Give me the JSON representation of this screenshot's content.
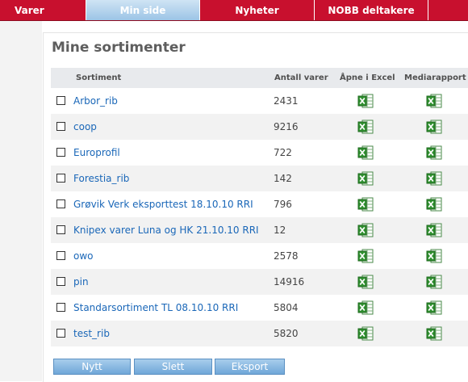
{
  "nav": {
    "tabs": [
      {
        "label": "Varer"
      },
      {
        "label": "Min side"
      },
      {
        "label": "Nyheter"
      },
      {
        "label": "NOBB deltakere"
      }
    ]
  },
  "main": {
    "title": "Mine sortimenter",
    "columns": {
      "sortiment": "Sortiment",
      "antall": "Antall varer",
      "excel": "Åpne i Excel",
      "media": "Mediarapport"
    },
    "rows": [
      {
        "name": "Arbor_rib",
        "count": "2431"
      },
      {
        "name": "coop",
        "count": "9216"
      },
      {
        "name": "Europrofil",
        "count": "722"
      },
      {
        "name": "Forestia_rib",
        "count": "142"
      },
      {
        "name": "Grøvik Verk eksporttest 18.10.10 RRI",
        "count": "796"
      },
      {
        "name": "Knipex varer Luna og HK 21.10.10 RRI",
        "count": "12"
      },
      {
        "name": "owo",
        "count": "2578"
      },
      {
        "name": "pin",
        "count": "14916"
      },
      {
        "name": "Standarsortiment TL 08.10.10 RRI",
        "count": "5804"
      },
      {
        "name": "test_rib",
        "count": "5820"
      }
    ],
    "buttons": {
      "new": "Nytt",
      "delete": "Slett",
      "export": "Eksport"
    }
  },
  "colors": {
    "nav_bg": "#c8102e",
    "link": "#1a67b8",
    "excel_green": "#2f8f2f"
  },
  "icons": {
    "excel": "excel-icon"
  }
}
